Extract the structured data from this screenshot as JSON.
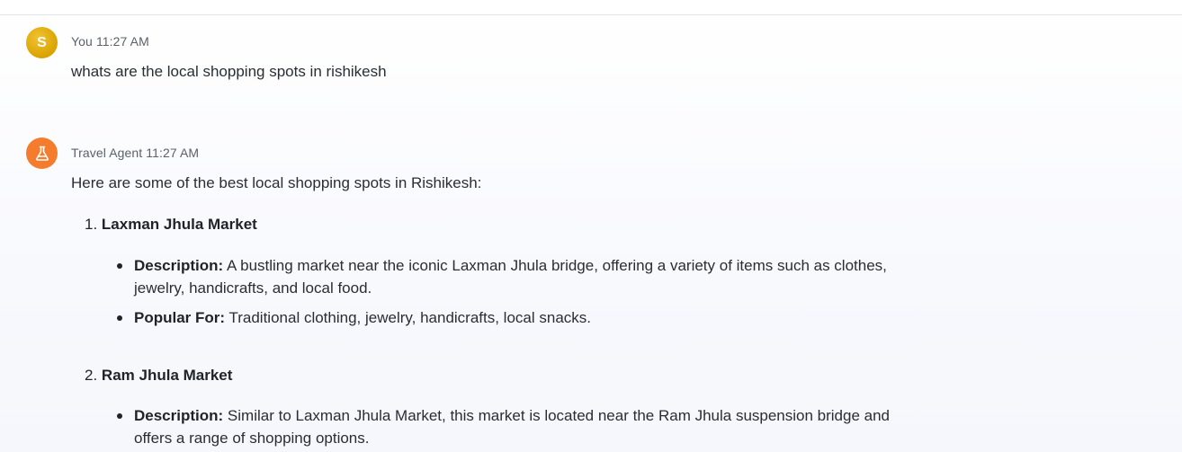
{
  "user_message": {
    "avatar_initial": "S",
    "sender": "You",
    "time": "11:27 AM",
    "text": "whats are the local shopping spots in rishikesh"
  },
  "agent_message": {
    "avatar_icon": "flask-icon",
    "sender": "Travel Agent",
    "time": "11:27 AM",
    "intro": "Here are some of the best local shopping spots in Rishikesh:",
    "items": [
      {
        "number": "1.",
        "title": "Laxman Jhula Market",
        "bullets": [
          {
            "label": "Description:",
            "line1": "A bustling market near the iconic Laxman Jhula bridge, offering a variety of items such as clothes,",
            "line2": "jewelry, handicrafts, and local food."
          },
          {
            "label": "Popular For:",
            "line1": "Traditional clothing, jewelry, handicrafts, local snacks.",
            "line2": ""
          }
        ]
      },
      {
        "number": "2.",
        "title": "Ram Jhula Market",
        "bullets": [
          {
            "label": "Description:",
            "line1": "Similar to Laxman Jhula Market, this market is located near the Ram Jhula suspension bridge and",
            "line2": "offers a range of shopping options."
          }
        ]
      }
    ]
  },
  "colors": {
    "user_avatar": "#d9a300",
    "agent_avatar": "#f47c2c"
  }
}
